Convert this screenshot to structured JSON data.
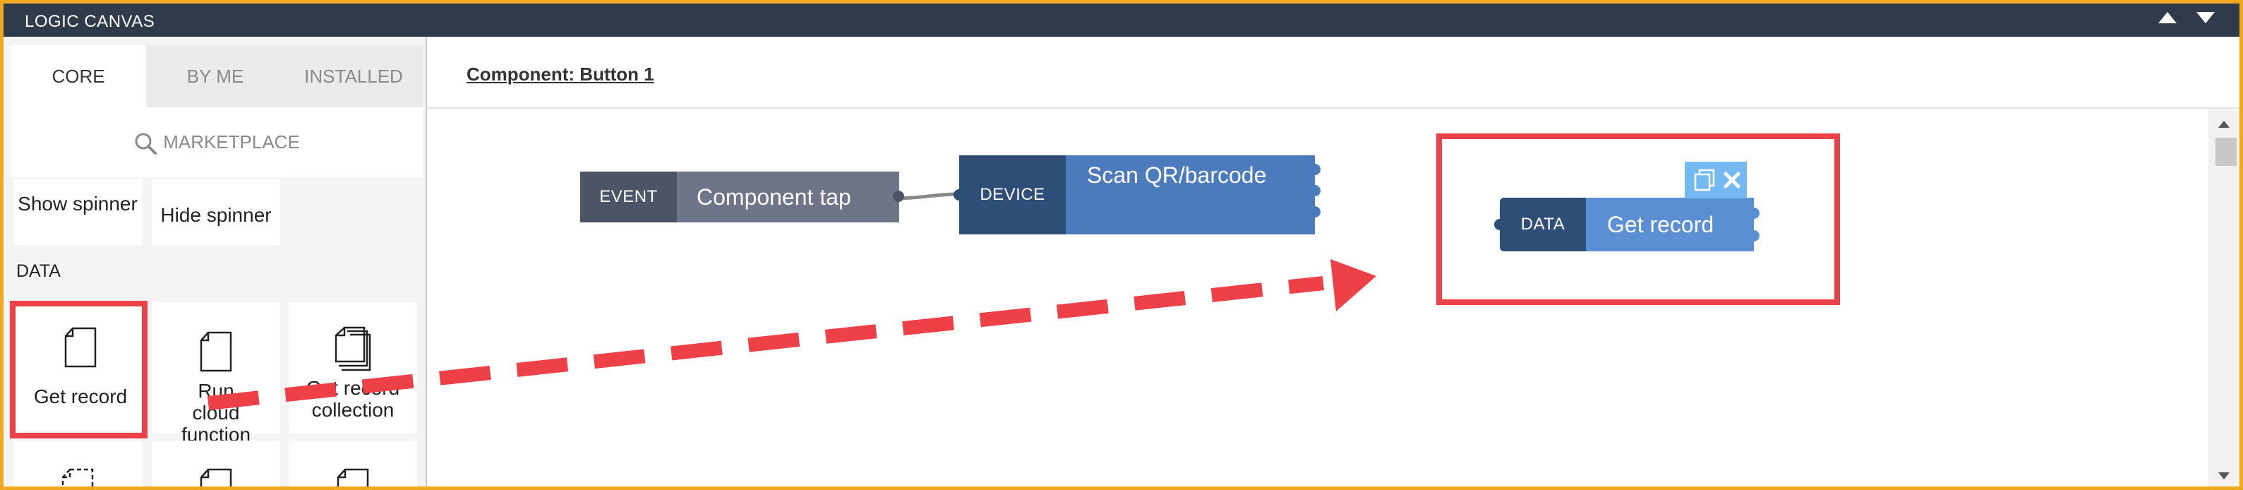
{
  "window": {
    "title": "LOGIC CANVAS"
  },
  "tabs": [
    {
      "label": "CORE",
      "active": true
    },
    {
      "label": "BY ME",
      "active": false
    },
    {
      "label": "INSTALLED",
      "active": false
    }
  ],
  "marketplace": {
    "label": "MARKETPLACE",
    "icon": "search-icon"
  },
  "tiles_top": [
    {
      "label": "Show spinner"
    },
    {
      "label": "Hide spinner"
    }
  ],
  "data_section": {
    "label": "DATA"
  },
  "data_tiles": [
    {
      "label": "Get record",
      "icon": "document-icon"
    },
    {
      "label": "Run cloud function",
      "icon": "document-icon"
    },
    {
      "label": "Get record collection",
      "icon": "documents-stack-icon"
    }
  ],
  "component_link": "Component: Button 1",
  "blocks": {
    "event": {
      "tag": "EVENT",
      "label": "Component tap"
    },
    "device": {
      "tag": "DEVICE",
      "label": "Scan QR/barcode"
    },
    "data": {
      "tag": "DATA",
      "label": "Get record"
    }
  },
  "colors": {
    "header": "#2f3a4a",
    "frame": "#f0a81c",
    "event_tag": "#4b5566",
    "event_body": "#6e7589",
    "device_tag": "#2e4e78",
    "device_body": "#4c7bbd",
    "highlight": "#ee4147",
    "toolbar": "#74b9f2"
  }
}
